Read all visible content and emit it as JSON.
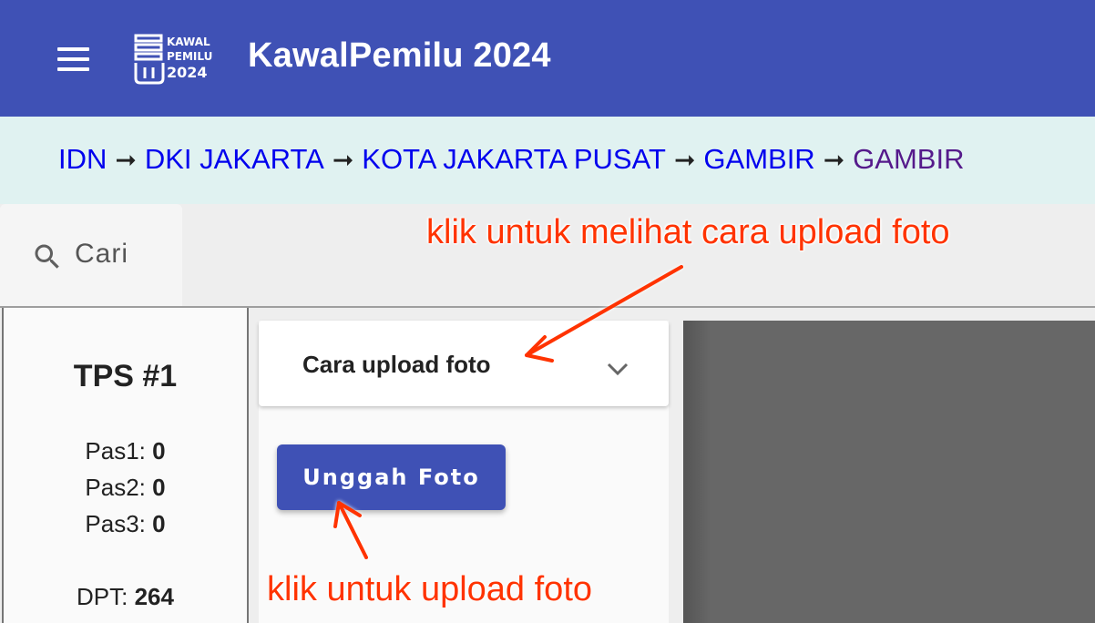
{
  "header": {
    "title": "KawalPemilu 2024",
    "logo_lines": [
      "KAWAL",
      "PEMILU",
      "2024"
    ],
    "menu_icon": "hamburger-menu-icon",
    "background": "#3f51b5"
  },
  "breadcrumb": {
    "items": [
      "IDN",
      "DKI JAKARTA",
      "KOTA JAKARTA PUSAT",
      "GAMBIR",
      "GAMBIR"
    ],
    "separator": "➞"
  },
  "search": {
    "label": "Cari",
    "icon": "search-icon"
  },
  "tps": {
    "title": "TPS #1",
    "stats": [
      {
        "label": "Pas1:",
        "value": "0"
      },
      {
        "label": "Pas2:",
        "value": "0"
      },
      {
        "label": "Pas3:",
        "value": "0"
      }
    ],
    "dpt_label": "DPT:",
    "dpt_value": "264"
  },
  "upload": {
    "expander_title": "Cara upload foto",
    "chevron_icon": "chevron-down-icon",
    "button_label": "Unggah Foto"
  },
  "annotations": {
    "top": "klik untuk melihat cara upload foto",
    "bottom": "klik untuk upload foto",
    "color": "#ff3300"
  }
}
